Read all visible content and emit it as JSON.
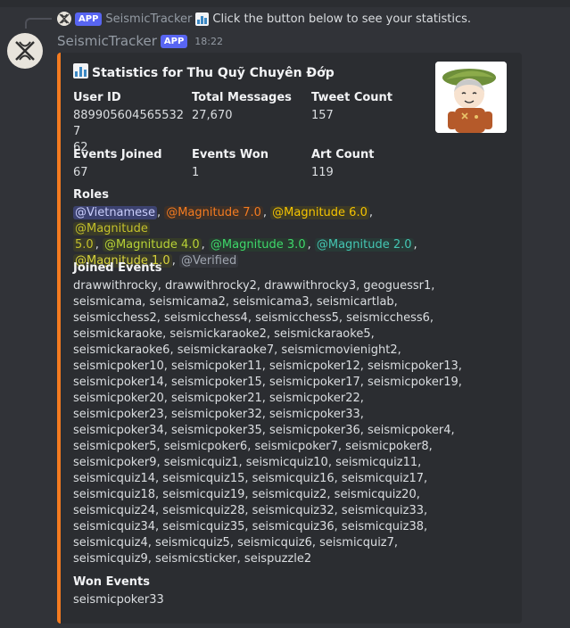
{
  "reply": {
    "app_tag": "APP",
    "bot_name": "SeismicTracker",
    "text": "Click the button below to see your statistics."
  },
  "message": {
    "username": "SeismicTracker",
    "app_tag": "APP",
    "timestamp": "18:22"
  },
  "embed": {
    "accent_color": "#f47b20",
    "title": "Statistics for Thu Quỹ Chuyên Đớp",
    "fields": {
      "user_id": {
        "name": "User ID",
        "lines": [
          "8899056045655327",
          "62"
        ]
      },
      "total_messages": {
        "name": "Total Messages",
        "value": "27,670"
      },
      "tweet_count": {
        "name": "Tweet Count",
        "value": "157"
      },
      "events_joined": {
        "name": "Events Joined",
        "value": "67"
      },
      "events_won": {
        "name": "Events Won",
        "value": "1"
      },
      "art_count": {
        "name": "Art Count",
        "value": "119"
      }
    },
    "roles": {
      "name": "Roles",
      "items": [
        {
          "label": "@Vietnamese",
          "color": "#c9cdfb",
          "bg": "#3c4270"
        },
        {
          "label": "@Magnitude 7.0",
          "color": "#f47b20",
          "bg": "#3d3028"
        },
        {
          "label": "@Magnitude 6.0",
          "color": "#f5c400",
          "bg": "#3d3a26"
        },
        {
          "label": "@Magnitude 5.0",
          "color": "#c3c02b",
          "bg": "#3a3b28"
        },
        {
          "label": "@Magnitude 4.0",
          "color": "#b8d236",
          "bg": "#363c28"
        },
        {
          "label": "@Magnitude 3.0",
          "color": "#3ed96b",
          "bg": "#28392f"
        },
        {
          "label": "@Magnitude 2.0",
          "color": "#44c6b3",
          "bg": "#283936"
        },
        {
          "label": "@Magnitude 1.0",
          "color": "#d7d33c",
          "bg": "#393a29"
        },
        {
          "label": "@Verified",
          "color": "#a0a6b0",
          "bg": "#34363c"
        }
      ],
      "lines": [
        [
          {
            "i": 0,
            "sep": ", "
          },
          {
            "i": 1,
            "sep": ", "
          },
          {
            "i": 2,
            "sep": ", "
          },
          {
            "i": 3,
            "part": "@Magnitude"
          }
        ],
        [
          {
            "i": 3,
            "part": "5.0",
            "sep": ", "
          },
          {
            "i": 4,
            "sep": ", "
          },
          {
            "i": 5,
            "sep": ", "
          },
          {
            "i": 6,
            "sep": ", "
          }
        ],
        [
          {
            "i": 7,
            "sep": ", "
          },
          {
            "i": 8
          }
        ]
      ]
    },
    "joined_events": {
      "name": "Joined Events",
      "lines": [
        "drawwithrocky, drawwithrocky2, drawwithrocky3, geoguessr1,",
        "seismicama, seismicama2, seismicama3, seismicartlab,",
        "seismicchess2, seismicchess4, seismicchess5, seismicchess6,",
        "seismickaraoke, seismickaraoke2, seismickaraoke5,",
        "seismickaraoke6, seismickaraoke7, seismicmovienight2,",
        "seismicpoker10, seismicpoker11, seismicpoker12, seismicpoker13,",
        "seismicpoker14, seismicpoker15, seismicpoker17, seismicpoker19,",
        "seismicpoker20, seismicpoker21, seismicpoker22,",
        "seismicpoker23, seismicpoker32, seismicpoker33,",
        "seismicpoker34, seismicpoker35, seismicpoker36, seismicpoker4,",
        "seismicpoker5, seismicpoker6, seismicpoker7, seismicpoker8,",
        "seismicpoker9, seismicquiz1, seismicquiz10, seismicquiz11,",
        "seismicquiz14, seismicquiz15, seismicquiz16, seismicquiz17,",
        "seismicquiz18, seismicquiz19, seismicquiz2, seismicquiz20,",
        "seismicquiz24, seismicquiz28, seismicquiz32, seismicquiz33,",
        "seismicquiz34, seismicquiz35, seismicquiz36, seismicquiz38,",
        "seismicquiz4, seismicquiz5, seismicquiz6, seismicquiz7,",
        "seismicquiz9, seismicsticker, seispuzzle2"
      ]
    },
    "won_events": {
      "name": "Won Events",
      "lines": [
        "seismicpoker33"
      ]
    }
  }
}
